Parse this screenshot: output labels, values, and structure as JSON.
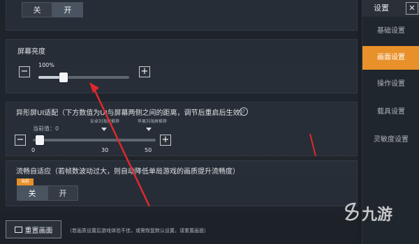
{
  "top_toggle": {
    "off_label": "关",
    "on_label": "开",
    "state": "on"
  },
  "brightness": {
    "label": "屏幕亮度",
    "value_text": "100%",
    "level_fraction": 0.28,
    "minus": "−",
    "plus": "+"
  },
  "ui_adapt": {
    "label": "异形屏UI适配（下方数值为UI与屏幕两侧之间的距离，调节后重启后生效）",
    "help": "?",
    "current_text": "当前值：0",
    "marker_left": "安卓刘海屏推荐",
    "marker_right": "苹果刘海屏推荐",
    "ticks": [
      "0",
      "30",
      "50"
    ],
    "current_value": 0,
    "min": 0,
    "max": 50,
    "minus": "−",
    "plus": "+"
  },
  "smooth_adapt": {
    "label": "流畅自适应（若帧数波动过大，则自动降低单局游戏的画质提升流畅度）",
    "badge": "当前",
    "off_label": "关",
    "on_label": "开",
    "state": "off"
  },
  "reset": {
    "label": "重置画面",
    "note": "（若画质设置后游戏体验不佳，或需恢复默认设置，请重置画面）"
  },
  "sidebar": {
    "title": "设置",
    "close": "✕",
    "items": [
      {
        "label": "基础设置",
        "active": false
      },
      {
        "label": "画面设置",
        "active": true
      },
      {
        "label": "操作设置",
        "active": false
      },
      {
        "label": "载具设置",
        "active": false
      },
      {
        "label": "灵敏度设置",
        "active": false
      }
    ]
  },
  "watermark": {
    "text": "九游"
  },
  "colors": {
    "accent": "#e8912b",
    "annotation": "#e0282c"
  }
}
